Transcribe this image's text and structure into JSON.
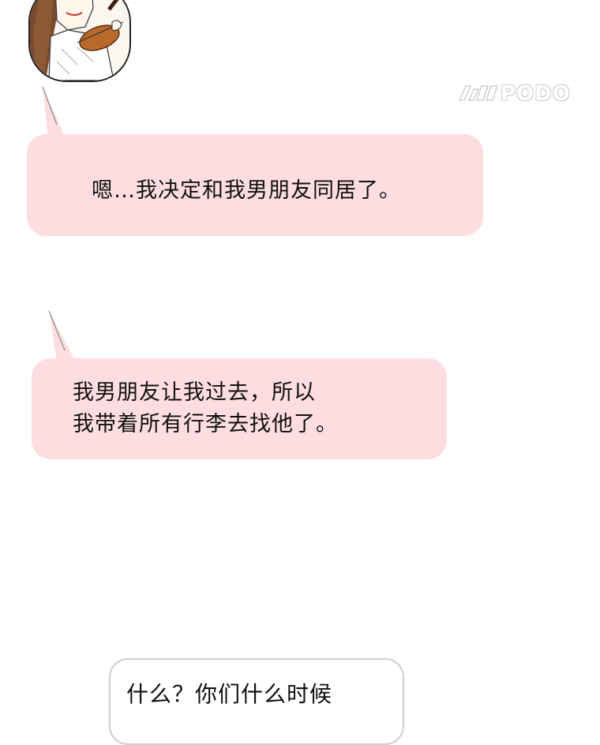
{
  "watermark": {
    "brand": "PODO",
    "logo_icon": "kakao-page-logo-icon"
  },
  "avatar": {
    "icon": "woman-with-violin-avatar"
  },
  "messages": [
    {
      "text": "嗯…我决定和我男朋友同居了。",
      "style": "pink",
      "tail": "up-left"
    },
    {
      "lines": [
        "我男朋友让我过去，所以",
        "我带着所有行李去找他了。"
      ],
      "style": "pink",
      "tail": "up-left"
    },
    {
      "text": "什么？你们什么时候",
      "style": "white-outlined"
    }
  ],
  "colors": {
    "bubble_pink": "#fddde0",
    "bubble_outline": "#cfcfcf",
    "text": "#111111",
    "background": "#ffffff"
  }
}
